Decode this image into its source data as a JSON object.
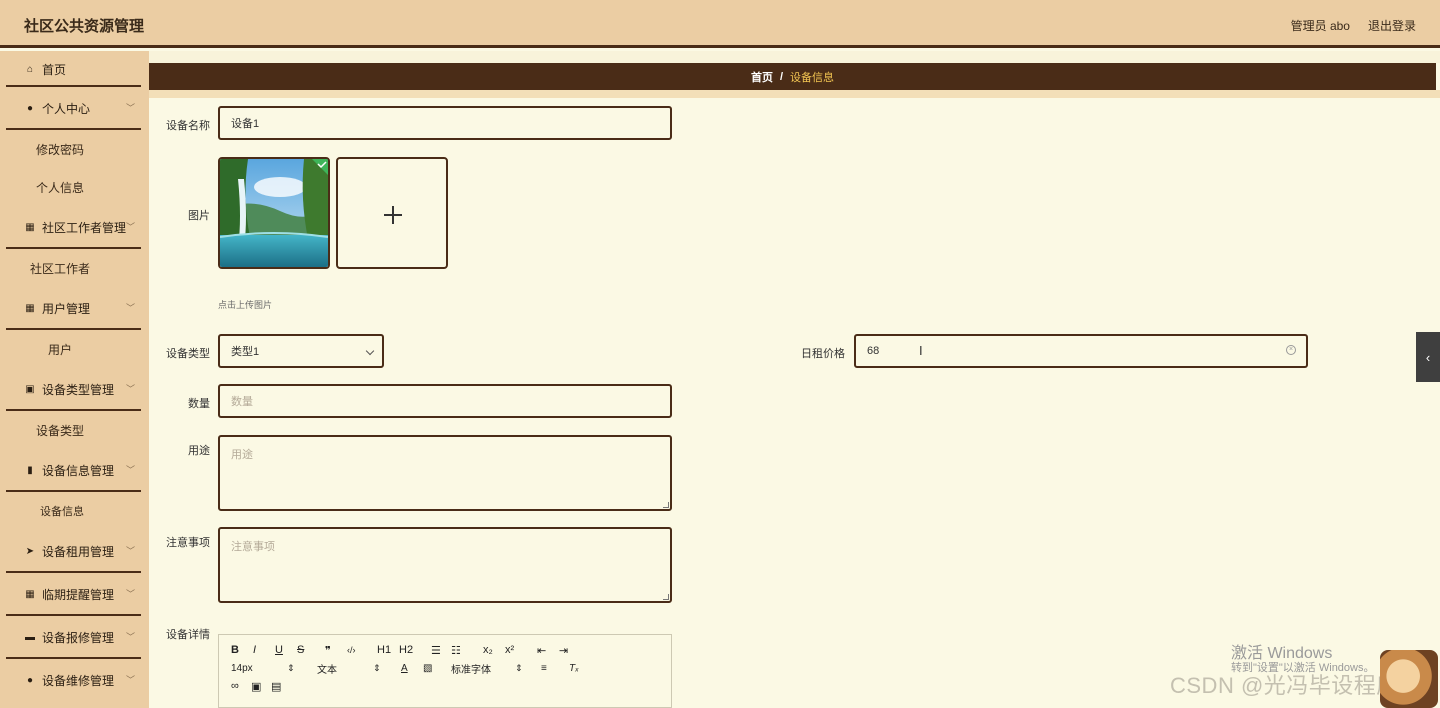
{
  "app": {
    "title": "社区公共资源管理"
  },
  "header": {
    "user": "管理员 abo",
    "logout": "退出登录"
  },
  "sidebar": {
    "home": "首页",
    "personal_center": "个人中心",
    "personal_sub": [
      "修改密码",
      "个人信息"
    ],
    "worker_mgmt": "社区工作者管理",
    "worker_sub": "社区工作者",
    "user_mgmt": "用户管理",
    "user_sub": "用户",
    "device_type_mgmt": "设备类型管理",
    "device_type_sub": "设备类型",
    "device_info_mgmt": "设备信息管理",
    "device_info_sub": "设备信息",
    "device_rent_mgmt": "设备租用管理",
    "expiry_mgmt": "临期提醒管理",
    "repair_report_mgmt": "设备报修管理",
    "maintenance_mgmt": "设备维修管理"
  },
  "breadcrumb": {
    "home": "首页",
    "separator": "/",
    "current": "设备信息"
  },
  "form": {
    "name_label": "设备名称",
    "name_value": "设备1",
    "image_label": "图片",
    "upload_hint": "点击上传图片",
    "type_label": "设备类型",
    "type_value": "类型1",
    "price_label": "日租价格",
    "price_value": "68",
    "qty_label": "数量",
    "qty_placeholder": "数量",
    "usage_label": "用途",
    "usage_placeholder": "用途",
    "notes_label": "注意事项",
    "notes_placeholder": "注意事项",
    "detail_label": "设备详情"
  },
  "editor": {
    "row1": [
      "B",
      "I",
      "U",
      "S",
      "❞",
      "‹/›",
      "H1",
      "H2",
      "☰",
      "☷",
      "x₂",
      "x²",
      "⇤",
      "⇥"
    ],
    "font_size": "14px",
    "text_format": "文本",
    "font_family": "标准字体"
  },
  "overlay": {
    "activate_title": "激活 Windows",
    "activate_sub": "转到\"设置\"以激活 Windows。",
    "csdn": "CSDN @光冯毕设程序"
  }
}
